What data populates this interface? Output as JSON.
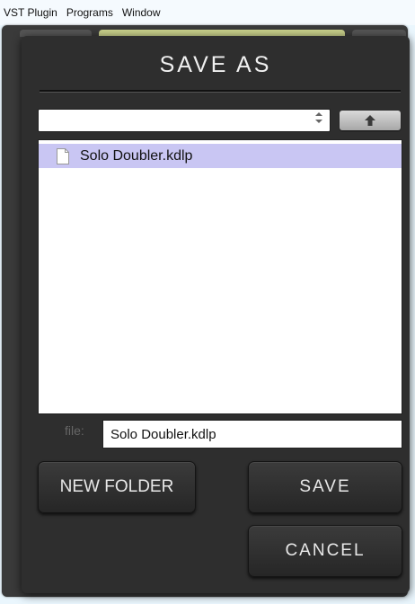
{
  "menubar": {
    "items": [
      "VST Plugin",
      "Programs",
      "Window"
    ]
  },
  "dialog": {
    "title": "SAVE AS",
    "path_select": {
      "value": "",
      "arrows_icon": "up-down-arrows-icon"
    },
    "up_button": {
      "icon": "arrow-up-icon"
    },
    "files": [
      {
        "name": "Solo Doubler.kdlp",
        "icon": "document-icon",
        "selected": true
      }
    ],
    "file_field": {
      "label": "file:",
      "value": "Solo Doubler.kdlp"
    },
    "buttons": {
      "new_folder": "NEW FOLDER",
      "save": "SAVE",
      "cancel": "CANCEL"
    }
  },
  "colors": {
    "selection": "#c9c6f3",
    "dialog_bg": "#2e2e2e",
    "tab_accent": "#c8cf8a"
  }
}
